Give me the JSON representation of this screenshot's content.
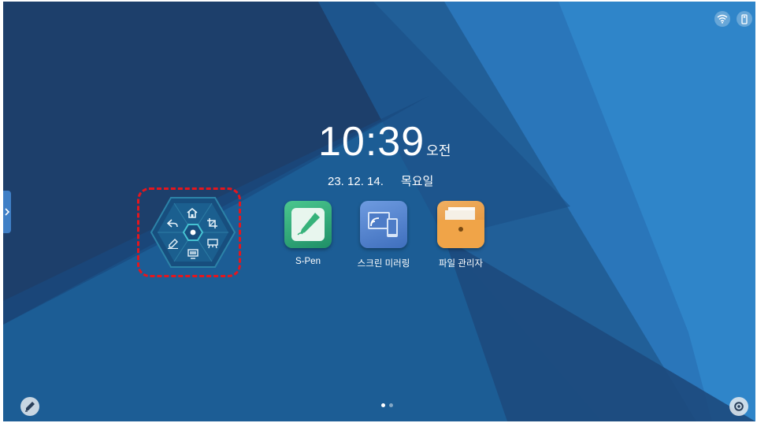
{
  "clock": {
    "time": "10:39",
    "ampm": "오전"
  },
  "date": {
    "day": "23. 12. 14.",
    "weekday": "목요일"
  },
  "apps": [
    {
      "label": "S-Pen",
      "icon": "pen-note-icon"
    },
    {
      "label": "스크린 미러링",
      "icon": "screen-mirroring-icon"
    },
    {
      "label": "파일 관리자",
      "icon": "folder-icon"
    }
  ],
  "status_icons": [
    "wifi-icon",
    "usb-icon"
  ],
  "quick_menu": {
    "icons": [
      "home-icon",
      "crop-icon",
      "whiteboard-icon",
      "screen-icon",
      "pen-icon",
      "back-icon",
      "center-dot-icon"
    ]
  },
  "pager": {
    "pages": 2,
    "current": 1
  },
  "colors": {
    "dark_blue": "#1d3f6b",
    "mid_blue": "#1f5f97",
    "bright_blue": "#2a7bc1",
    "highlight_red": "#e5161d",
    "quick_menu_teal": "#2fa4b8"
  }
}
